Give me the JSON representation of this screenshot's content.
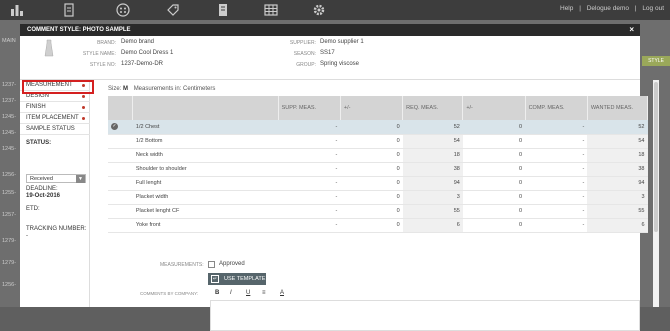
{
  "topbar": {
    "help": "Help",
    "user": "Delogue demo",
    "logout": "Log out"
  },
  "background": {
    "left_strip": [
      "MAIN",
      "1237-",
      "1237-",
      "1245-",
      "1245-",
      "1245-",
      "1256-",
      "1255-",
      "1257-",
      "1279-",
      "1279-",
      "1256-"
    ],
    "right_button": "STYLE"
  },
  "modal": {
    "title": "COMMENT STYLE: PHOTO SAMPLE",
    "close": "×",
    "info": {
      "brand_label": "BRAND:",
      "brand_value": "Demo brand",
      "style_name_label": "STYLE NAME:",
      "style_name_value": "Demo Cool Dress 1",
      "style_no_label": "STYLE NO:",
      "style_no_value": "1237-Demo-DR",
      "supplier_label": "SUPPLIER:",
      "supplier_value": "Demo supplier 1",
      "season_label": "SEASON:",
      "season_value": "SS17",
      "group_label": "GROUP:",
      "group_value": "Spring viscose"
    }
  },
  "sidebar": {
    "items": [
      {
        "label": "MEASUREMENT",
        "dot": true
      },
      {
        "label": "DESIGN",
        "dot": true
      },
      {
        "label": "FINISH",
        "dot": true
      },
      {
        "label": "ITEM PLACEMENT",
        "dot": true
      },
      {
        "label": "SAMPLE STATUS",
        "dot": false
      }
    ],
    "status_label": "STATUS:",
    "status_value": "Received",
    "deadline_label": "DEADLINE:",
    "deadline_value": "19-Oct-2016",
    "etd_label": "ETD:",
    "tracking_label": "TRACKING NUMBER:",
    "tracking_value": "-"
  },
  "measurement": {
    "size_label": "Size:",
    "size_value": "M",
    "measurements_in_label": "Measurements in:",
    "measurements_in_value": "Centimeters",
    "columns": [
      "",
      "",
      "SUPP. MEAS.",
      "+/-",
      "REQ. MEAS.",
      "+/-",
      "COMP. MEAS.",
      "WANTED MEAS."
    ],
    "rows": [
      {
        "name": "1/2 Chest",
        "supp": "-",
        "diff1": "0",
        "req": "52",
        "diff2": "0",
        "comp": "-",
        "wanted": "52",
        "selected": true
      },
      {
        "name": "1/2 Bottom",
        "supp": "-",
        "diff1": "0",
        "req": "54",
        "diff2": "0",
        "comp": "-",
        "wanted": "54",
        "selected": false
      },
      {
        "name": "Neck width",
        "supp": "-",
        "diff1": "0",
        "req": "18",
        "diff2": "0",
        "comp": "-",
        "wanted": "18",
        "selected": false
      },
      {
        "name": "Shoulder to shoulder",
        "supp": "-",
        "diff1": "0",
        "req": "38",
        "diff2": "0",
        "comp": "-",
        "wanted": "38",
        "selected": false
      },
      {
        "name": "Full lenght",
        "supp": "-",
        "diff1": "0",
        "req": "94",
        "diff2": "0",
        "comp": "-",
        "wanted": "94",
        "selected": false
      },
      {
        "name": "Placket width",
        "supp": "-",
        "diff1": "0",
        "req": "3",
        "diff2": "0",
        "comp": "-",
        "wanted": "3",
        "selected": false
      },
      {
        "name": "Placket lenght CF",
        "supp": "-",
        "diff1": "0",
        "req": "55",
        "diff2": "0",
        "comp": "-",
        "wanted": "55",
        "selected": false
      },
      {
        "name": "Yoke front",
        "supp": "-",
        "diff1": "0",
        "req": "6",
        "diff2": "0",
        "comp": "-",
        "wanted": "6",
        "selected": false
      }
    ],
    "measurements_label": "MEASUREMENTS:",
    "approved_label": "Approved",
    "use_template_label": "USE TEMPLATE",
    "comments_label": "COMMENTS BY COMPANY:",
    "toolbar": [
      "B",
      "I",
      "U",
      "≡",
      "A"
    ]
  }
}
